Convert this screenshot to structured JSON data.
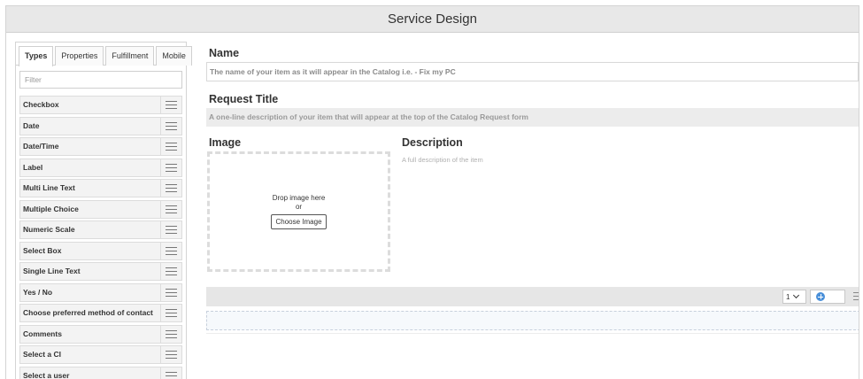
{
  "window": {
    "title": "Service Design"
  },
  "left_panel": {
    "tabs": [
      {
        "label": "Types",
        "active": true
      },
      {
        "label": "Properties",
        "active": false
      },
      {
        "label": "Fulfillment",
        "active": false
      },
      {
        "label": "Mobile",
        "active": false
      }
    ],
    "filter_placeholder": "Filter",
    "types": [
      "Checkbox",
      "Date",
      "Date/Time",
      "Label",
      "Multi Line Text",
      "Multiple Choice",
      "Numeric Scale",
      "Select Box",
      "Single Line Text",
      "Yes / No",
      "Choose preferred method of contact",
      "Comments",
      "Select a CI",
      "Select a user"
    ]
  },
  "form": {
    "name_label": "Name",
    "name_placeholder": "The name of your item as it will appear in the Catalog i.e. - Fix my PC",
    "request_title_label": "Request Title",
    "request_title_placeholder": "A one-line description of your item that will appear at the top of the Catalog Request form",
    "image_label": "Image",
    "drop_line1": "Drop image here",
    "drop_line2": "or",
    "choose_image": "Choose Image",
    "description_label": "Description",
    "description_placeholder": "A full description of the item"
  },
  "toolbar": {
    "columns_value": "1"
  },
  "colors": {
    "accent": "#4a90d9"
  }
}
